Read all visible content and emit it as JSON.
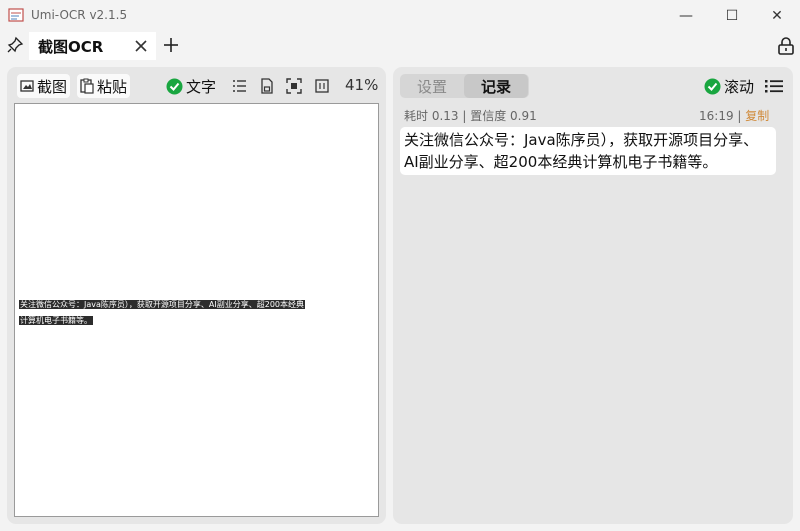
{
  "window": {
    "title": "Umi-OCR v2.1.5",
    "minimize_glyph": "—",
    "maximize_glyph": "☐",
    "close_glyph": "✕"
  },
  "tabs": {
    "active_label": "截图OCR",
    "add_glyph": "+"
  },
  "left": {
    "screenshot_label": "截图",
    "paste_label": "粘贴",
    "text_toggle_label": "文字",
    "zoom": "41%",
    "preview_line1": "关注微信公众号：Java陈序员），获取开源项目分享、AI副业分享、超200本经典",
    "preview_line2": "计算机电子书籍等。"
  },
  "right": {
    "tab_settings": "设置",
    "tab_records": "记录",
    "scroll_label": "滚动",
    "meta_time": "耗时 0.13 | 置信度 0.91",
    "clock": "16:19",
    "separator": "|",
    "copy_label": "复制",
    "result_text": "关注微信公众号：Java陈序员），获取开源项目分享、AI副业分享、超200本经典计算机电子书籍等。"
  },
  "colors": {
    "check_green": "#19a640",
    "copy_orange": "#d08a3a",
    "panel_bg": "#e6e6e6"
  }
}
